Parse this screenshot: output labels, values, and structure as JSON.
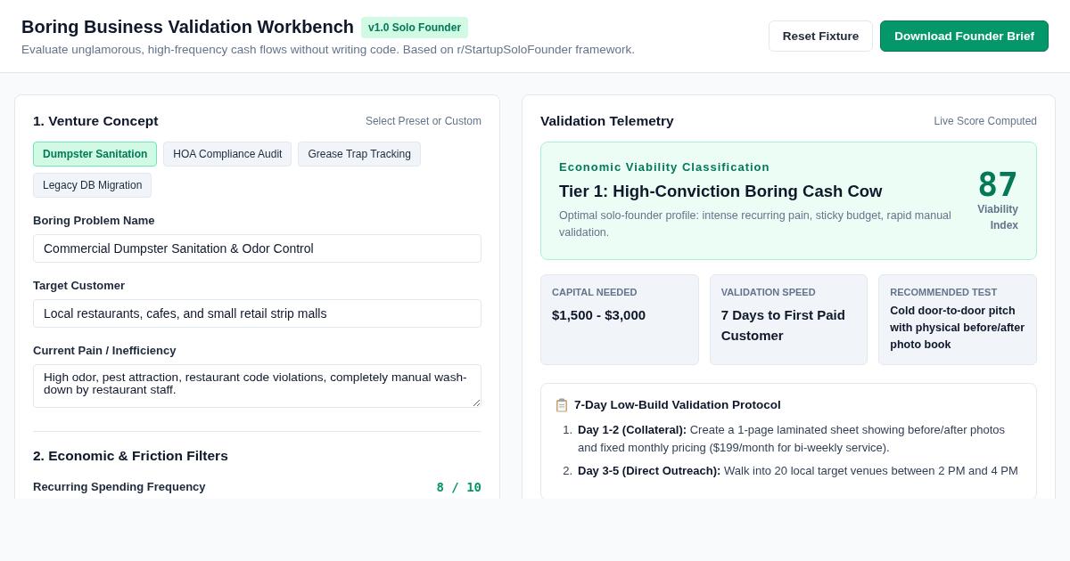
{
  "header": {
    "title": "Boring Business Validation Workbench",
    "badge": "v1.0 Solo Founder",
    "subtitle": "Evaluate unglamorous, high-frequency cash flows without writing code. Based on r/StartupSoloFounder framework.",
    "buttons": [
      {
        "label": "Reset Fixture",
        "kind": "secondary"
      },
      {
        "label": "Download Founder Brief",
        "kind": "primary"
      }
    ]
  },
  "concept": {
    "title": "1. Venture Concept",
    "hint": "Select Preset or Custom",
    "presets": [
      {
        "label": "Dumpster Sanitation",
        "selected": true
      },
      {
        "label": "HOA Compliance Audit",
        "selected": false
      },
      {
        "label": "Grease Trap Tracking",
        "selected": false
      },
      {
        "label": "Legacy DB Migration",
        "selected": false
      }
    ],
    "fields": [
      {
        "label": "Boring Problem Name",
        "value": "Commercial Dumpster Sanitation & Odor Control",
        "kind": "input"
      },
      {
        "label": "Target Customer",
        "value": "Local restaurants, cafes, and small retail strip malls",
        "kind": "input"
      },
      {
        "label": "Current Pain / Inefficiency",
        "value": "High odor, pest attraction, restaurant code violations, completely manual wash-down by restaurant staff.",
        "kind": "textarea"
      }
    ]
  },
  "filters": {
    "title": "2. Economic & Friction Filters",
    "items": [
      {
        "label": "Recurring Spending Frequency",
        "reading": "8 / 10"
      }
    ]
  },
  "telemetry": {
    "title": "Validation Telemetry",
    "hint": "Live Score Computed",
    "classification": {
      "eyebrow": "Economic Viability Classification",
      "tier": "Tier 1: High-Conviction Boring Cash Cow",
      "description": "Optimal solo-founder profile: intense recurring pain, sticky budget, rapid manual validation.",
      "score": "87",
      "score_label": "Viability Index"
    },
    "metrics": [
      {
        "label": "CAPITAL NEEDED",
        "value": "$1,500 - $3,000",
        "kind": "large"
      },
      {
        "label": "VALIDATION SPEED",
        "value": "7 Days to First Paid Customer",
        "kind": "large"
      },
      {
        "label": "RECOMMENDED TEST",
        "value": "Cold door-to-door pitch with physical before/after photo book",
        "kind": "small"
      }
    ],
    "protocol": {
      "title": "7-Day Low-Build Validation Protocol",
      "steps": [
        {
          "number": "1.",
          "text": "**Day 1-2 (Collateral):** Create a 1-page laminated sheet showing before/after photos and fixed monthly pricing ($199/month for bi-weekly service)."
        },
        {
          "number": "2.",
          "text": "**Day 3-5 (Direct Outreach):** Walk into 20 local target venues between 2 PM and 4 PM"
        }
      ]
    }
  }
}
